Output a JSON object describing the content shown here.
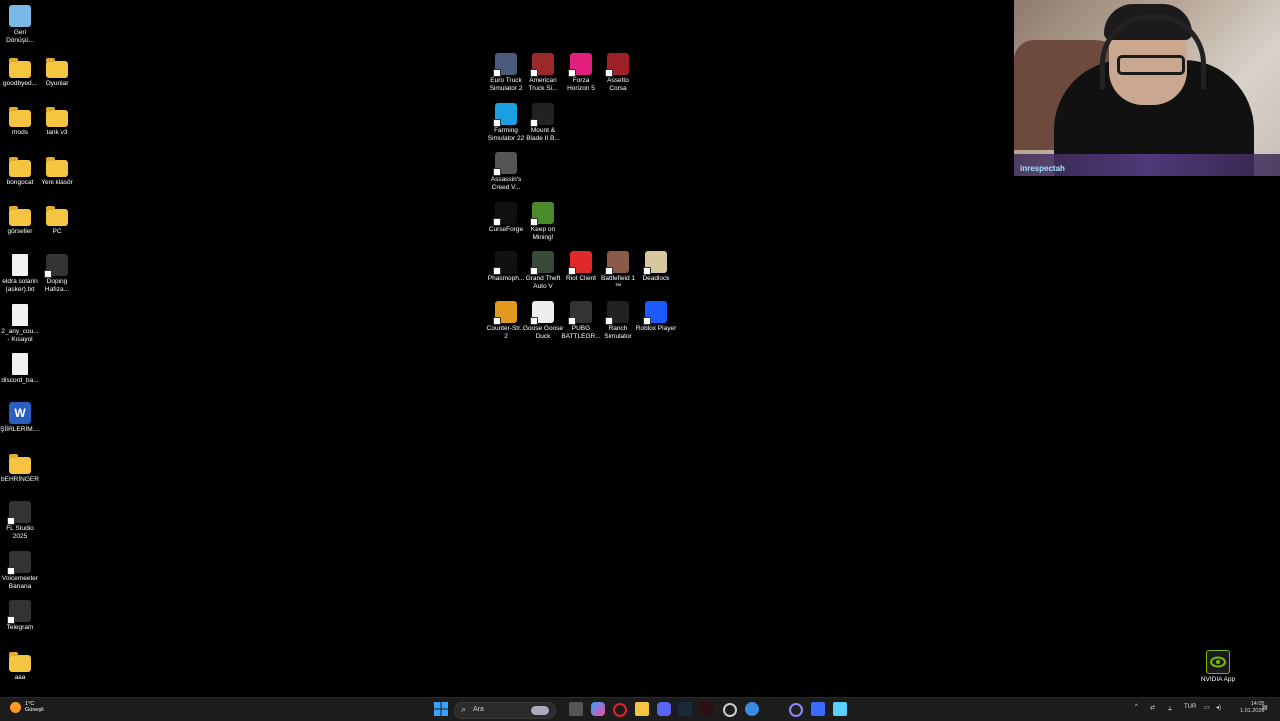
{
  "desktop": {
    "left_icons": [
      {
        "label": "Geri\nDönüşü...",
        "kind": "recycle"
      },
      {
        "label": "goodbyed...",
        "kind": "folder"
      },
      {
        "label": "Oyunlar",
        "kind": "folder"
      },
      {
        "label": "mods",
        "kind": "folder"
      },
      {
        "label": "tank v3",
        "kind": "folder"
      },
      {
        "label": "bongocat",
        "kind": "folder"
      },
      {
        "label": "Yeni klasör",
        "kind": "folder"
      },
      {
        "label": "görseller",
        "kind": "folder"
      },
      {
        "label": "PC",
        "kind": "folder"
      },
      {
        "label": "eldra solarin\n(asker).txt",
        "kind": "file"
      },
      {
        "label": "Doping\nHafıza...",
        "kind": "app"
      },
      {
        "label": "2_any_cou...\n- Kısayol",
        "kind": "file"
      },
      {
        "label": "discord_ba...",
        "kind": "file"
      },
      {
        "label": "ŞİİRLERİM....",
        "kind": "word"
      },
      {
        "label": "bEHRİNGER",
        "kind": "folder"
      },
      {
        "label": "FL Studio\n2025",
        "kind": "app"
      },
      {
        "label": "Voicemeeter\nBanana",
        "kind": "app"
      },
      {
        "label": "Telegram",
        "kind": "app"
      },
      {
        "label": "aaa",
        "kind": "folder"
      }
    ],
    "game_icons": [
      {
        "label": "Euro Truck\nSimulator 2",
        "color": "#4a5a7a"
      },
      {
        "label": "American\nTruck Si...",
        "color": "#9a2a2a"
      },
      {
        "label": "Forza\nHorizon 5",
        "color": "#e0207a"
      },
      {
        "label": "Assetto\nCorsa",
        "color": "#a0202a"
      },
      {
        "label": "Farming\nSimulator 22",
        "color": "#1aa0e0"
      },
      {
        "label": "Mount &\nBlade II B...",
        "color": "#222222"
      },
      {
        "label": "Assassin's\nCreed V...",
        "color": "#555555"
      },
      {
        "label": "CurseForge",
        "color": "#111111"
      },
      {
        "label": "Keep on\nMining!",
        "color": "#4a8a2a"
      },
      {
        "label": "Phasmoph...",
        "color": "#111111"
      },
      {
        "label": "Grand Theft\nAuto V",
        "color": "#3a4a3a"
      },
      {
        "label": "Riot Client",
        "color": "#e02a2a"
      },
      {
        "label": "Battlefield 1\n™",
        "color": "#8a5a4a"
      },
      {
        "label": "Deadlock",
        "color": "#d8c8a0"
      },
      {
        "label": "Counter-Str...\n2",
        "color": "#e09a20"
      },
      {
        "label": "Goose Goose\nDuck",
        "color": "#eeeeee"
      },
      {
        "label": "PUBG\nBATTLEGR...",
        "color": "#333333"
      },
      {
        "label": "Ranch\nSimulator",
        "color": "#222222"
      },
      {
        "label": "Roblox Player",
        "color": "#1a5aff"
      }
    ],
    "nvidia_label": "NVIDIA App"
  },
  "webcam": {
    "name": "inrespectah"
  },
  "taskbar": {
    "weather_temp": "1°C",
    "weather_desc": "Güneşli",
    "search_placeholder": "Ara",
    "language": "TUR",
    "time": "14:05",
    "date": "1.01.2026"
  }
}
